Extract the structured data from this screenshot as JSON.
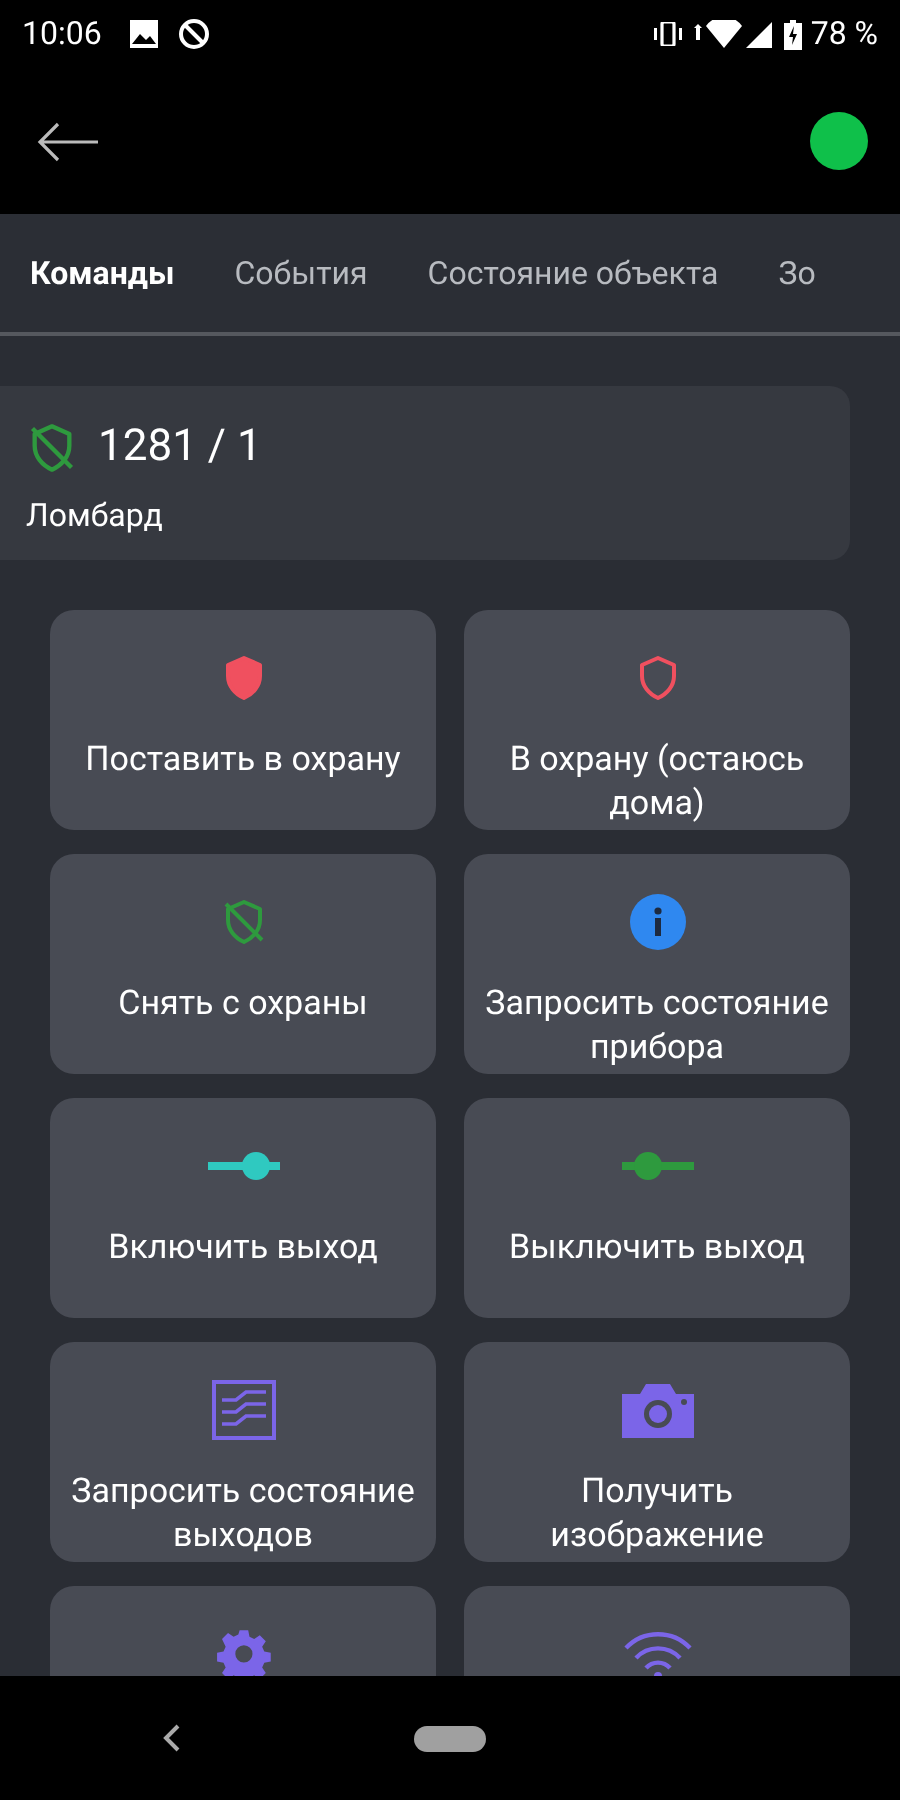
{
  "status_bar": {
    "time": "10:06",
    "battery": "78 %"
  },
  "tabs": [
    {
      "label": "Команды",
      "selected": true
    },
    {
      "label": "События",
      "selected": false
    },
    {
      "label": "Состояние объекта",
      "selected": false
    },
    {
      "label": "Зо",
      "selected": false
    }
  ],
  "object": {
    "number": "1281 / 1",
    "name": "Ломбард"
  },
  "commands": [
    {
      "kind": "arm",
      "label": "Поставить в охрану"
    },
    {
      "kind": "arm_home",
      "label": "В охрану (остаюсь дома)"
    },
    {
      "kind": "disarm",
      "label": "Снять с охраны"
    },
    {
      "kind": "info",
      "label": "Запросить состояние прибора"
    },
    {
      "kind": "output_on",
      "label": "Включить выход"
    },
    {
      "kind": "output_off",
      "label": "Выключить выход"
    },
    {
      "kind": "outputs_state",
      "label": "Запросить состояние выходов"
    },
    {
      "kind": "camera",
      "label": "Получить изображение"
    },
    {
      "kind": "settings"
    },
    {
      "kind": "wireless"
    }
  ]
}
